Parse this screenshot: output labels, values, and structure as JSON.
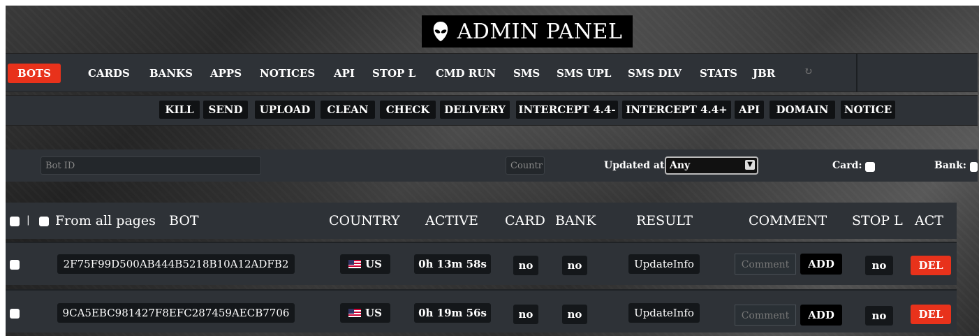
{
  "header": {
    "title": "ADMIN PANEL",
    "logo_icon": "alien-head-icon"
  },
  "nav": {
    "items": [
      {
        "label": "BOTS",
        "active": true
      },
      {
        "label": "CARDS"
      },
      {
        "label": "BANKS"
      },
      {
        "label": "APPS"
      },
      {
        "label": "NOTICES"
      },
      {
        "label": "API"
      },
      {
        "label": "STOP L"
      },
      {
        "label": "CMD RUN"
      },
      {
        "label": "SMS"
      },
      {
        "label": "SMS UPL"
      },
      {
        "label": "SMS DLV"
      },
      {
        "label": "STATS"
      },
      {
        "label": "JBR"
      }
    ],
    "refresh_icon": "refresh-icon",
    "active_color": "#e8321b"
  },
  "actions": {
    "buttons": [
      "KILL",
      "SEND",
      "UPLOAD",
      "CLEAN",
      "CHECK",
      "DELIVERY",
      "INTERCEPT 4.4-",
      "INTERCEPT 4.4+",
      "API",
      "DOMAIN",
      "NOTICE"
    ]
  },
  "filter": {
    "bot_id_placeholder": "Bot ID",
    "country_placeholder": "Countr",
    "updated_label": "Updated at:",
    "updated_value": "Any",
    "card_label": "Card:",
    "bank_label": "Bank:"
  },
  "table": {
    "headers": {
      "sep": "|",
      "from_all": "From all pages",
      "bot": "BOT",
      "country": "COUNTRY",
      "active": "ACTIVE",
      "card": "CARD",
      "bank": "BANK",
      "result": "RESULT",
      "comment": "COMMENT",
      "stopl": "STOP L",
      "act": "ACT"
    },
    "rows": [
      {
        "bot": "2F75F99D500AB444B5218B10A12ADFB2",
        "country": "US",
        "active": "0h 13m 58s",
        "card": "no",
        "bank": "no",
        "result": "UpdateInfo",
        "comment_placeholder": "Comment",
        "add": "ADD",
        "stopl": "no",
        "del": "DEL"
      },
      {
        "bot": "9CA5EBC981427F8EFC287459AECB7706",
        "country": "US",
        "active": "0h 19m 56s",
        "card": "no",
        "bank": "no",
        "result": "UpdateInfo",
        "comment_placeholder": "Comment",
        "add": "ADD",
        "stopl": "no",
        "del": "DEL"
      }
    ]
  }
}
